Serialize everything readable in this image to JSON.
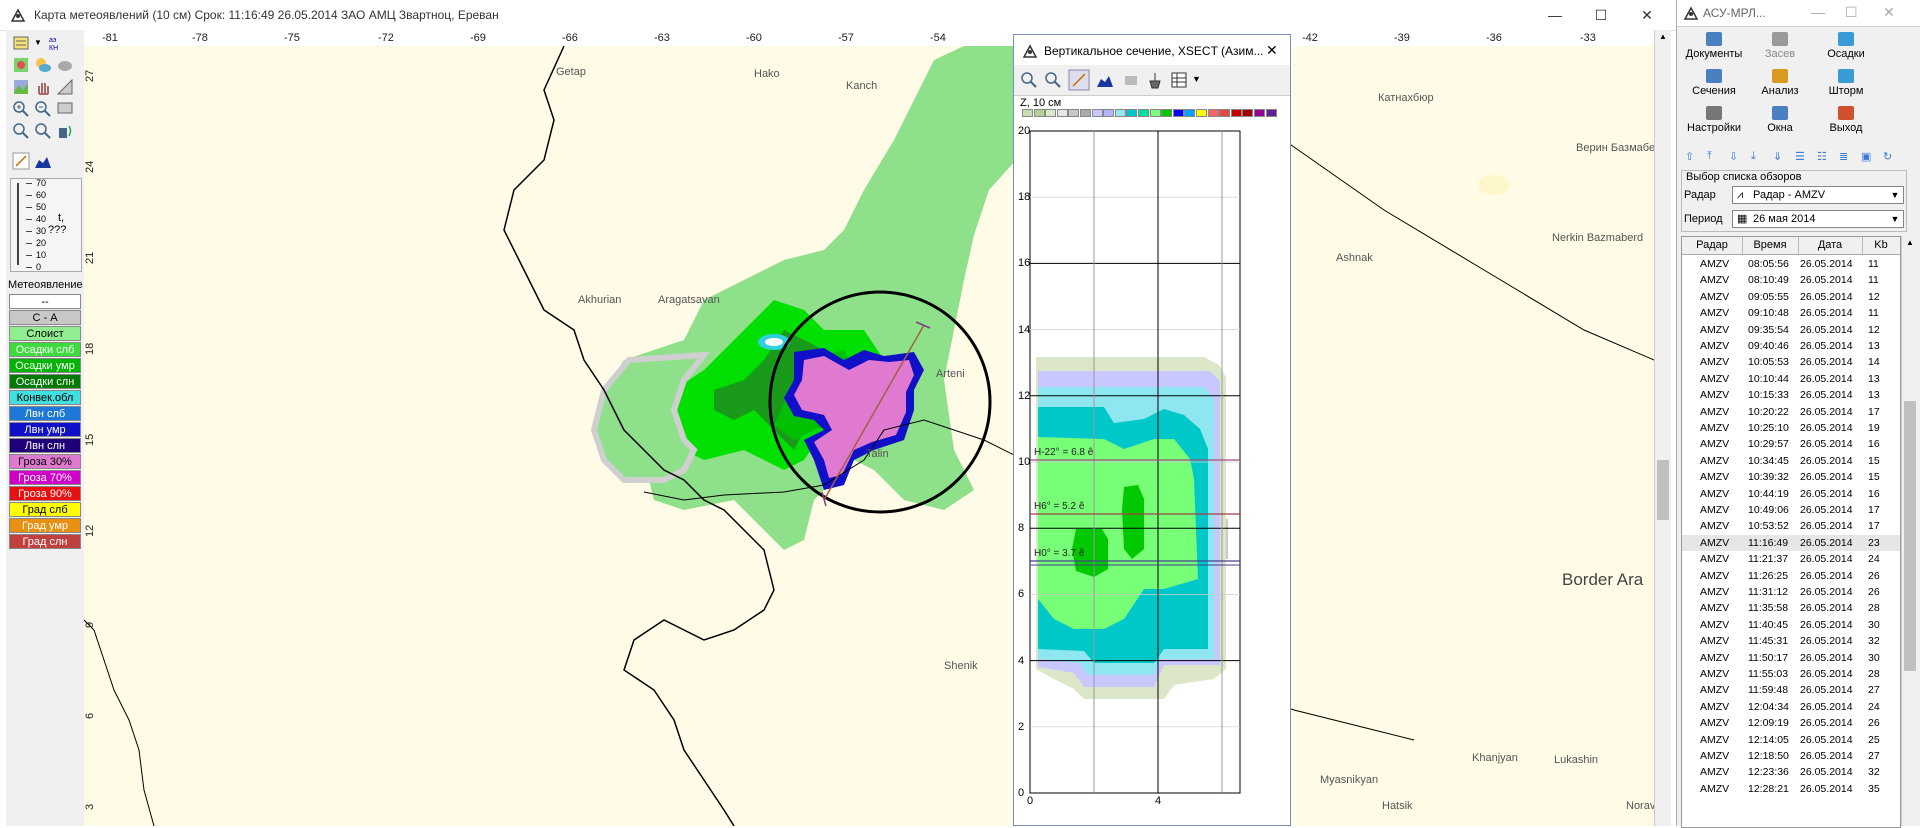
{
  "main_window": {
    "title": "Карта метеоявлений (10 см)   Срок: 11:16:49 26.05.2014   ЗАО АМЦ Звартноц, Ереван",
    "minimize": "—",
    "maximize": "☐",
    "close": "✕"
  },
  "toolbar": {
    "scale_values": [
      "70",
      "60",
      "50",
      "40",
      "30",
      "20",
      "10",
      "0"
    ],
    "scale_letter": "t,",
    "scale_unknown": "???",
    "legend_title": "Метеоявление",
    "legend_items": [
      {
        "label": "--",
        "bg": "#ffffff",
        "fg": "#000000"
      },
      {
        "label": "С - А",
        "bg": "#c8c8c8",
        "fg": "#000000"
      },
      {
        "label": "Слоист",
        "bg": "#90ee90",
        "fg": "#000000"
      },
      {
        "label": "Осадки слб",
        "bg": "#3cdc3c",
        "fg": "#ffffff"
      },
      {
        "label": "Осадки умр",
        "bg": "#00b400",
        "fg": "#ffffff"
      },
      {
        "label": "Осадки слн",
        "bg": "#007a00",
        "fg": "#ffffff"
      },
      {
        "label": "Конвек.обл",
        "bg": "#40e0e0",
        "fg": "#000000"
      },
      {
        "label": "Лвн слб",
        "bg": "#1e78d8",
        "fg": "#ffffff"
      },
      {
        "label": "Лвн умр",
        "bg": "#1010c8",
        "fg": "#ffffff"
      },
      {
        "label": "Лвн слн",
        "bg": "#200078",
        "fg": "#ffffff"
      },
      {
        "label": "Гроза 30%",
        "bg": "#e07ad0",
        "fg": "#000000"
      },
      {
        "label": "Гроза 70%",
        "bg": "#d000c8",
        "fg": "#ffffff"
      },
      {
        "label": "Гроза 90%",
        "bg": "#e81010",
        "fg": "#ffffff"
      },
      {
        "label": "Град слб",
        "bg": "#ffff00",
        "fg": "#000000"
      },
      {
        "label": "Град умр",
        "bg": "#e89010",
        "fg": "#ffffff"
      },
      {
        "label": "Град слн",
        "bg": "#c04040",
        "fg": "#ffffff"
      }
    ]
  },
  "map": {
    "x_ticks": [
      "-81",
      "-78",
      "-75",
      "-72",
      "-69",
      "-66",
      "-63",
      "-60",
      "-57",
      "-54",
      "-42",
      "-39",
      "-36",
      "-33"
    ],
    "y_ticks": [
      "27",
      "24",
      "21",
      "18",
      "15",
      "12",
      "9",
      "6",
      "3"
    ],
    "places": [
      "Getap",
      "Hako",
      "Kanch",
      "Akhurian",
      "Aragatsavan",
      "Arteni",
      "Talin",
      "Shenik",
      "Катнахбюр",
      "Верин Базмабе",
      "Nerkin Bazmaberd",
      "Ashnak",
      "Border Ara",
      "Khanjyan",
      "Lukashin",
      "Myasnikyan",
      "Hatsik",
      "Norav"
    ]
  },
  "vsec": {
    "title": "Вертикальное сечение, XSECT (Азим...",
    "close": "✕",
    "z_label": "Z, 10 см",
    "y_ticks": [
      "20",
      "18",
      "16",
      "14",
      "12",
      "10",
      "8",
      "6",
      "4",
      "2",
      "0"
    ],
    "x_ticks": [
      "0",
      "4"
    ],
    "h_labels": [
      "H-22° = 6.8 ê",
      "H6° = 5.2 ê",
      "H0° = 3.7 ê"
    ],
    "palette": [
      "#c8dcb4",
      "#b4d296",
      "#dce6c8",
      "#e6e6e6",
      "#c8c8c8",
      "#aaaaaa",
      "#c8c8ff",
      "#b4b4ff",
      "#96e6f0",
      "#00c8c8",
      "#00e0a0",
      "#78ff78",
      "#00c800",
      "#0000ff",
      "#00a0ff",
      "#ffff00",
      "#ff6464",
      "#e64646",
      "#c80000",
      "#a00000",
      "#960096",
      "#641e96"
    ]
  },
  "right_panel": {
    "title": "АСУ-МРЛ...",
    "big_buttons": [
      {
        "label": "Документы",
        "disabled": false
      },
      {
        "label": "Засев",
        "disabled": true
      },
      {
        "label": "Осадки",
        "disabled": false
      },
      {
        "label": "Сечения",
        "disabled": false
      },
      {
        "label": "Анализ",
        "disabled": false
      },
      {
        "label": "Шторм",
        "disabled": false
      },
      {
        "label": "Настройки",
        "disabled": false
      },
      {
        "label": "Окна",
        "disabled": false
      },
      {
        "label": "Выход",
        "disabled": false
      }
    ],
    "group_title": "Выбор списка обзоров",
    "radar_label": "Радар",
    "radar_value": "Радар - AMZV",
    "period_label": "Период",
    "period_value": "26 мая 2014",
    "columns": [
      "Радар",
      "Время",
      "Дата",
      "Kb"
    ],
    "rows": [
      [
        "AMZV",
        "08:05:56",
        "26.05.2014",
        "11"
      ],
      [
        "AMZV",
        "08:10:49",
        "26.05.2014",
        "11"
      ],
      [
        "AMZV",
        "09:05:55",
        "26.05.2014",
        "12"
      ],
      [
        "AMZV",
        "09:10:48",
        "26.05.2014",
        "11"
      ],
      [
        "AMZV",
        "09:35:54",
        "26.05.2014",
        "12"
      ],
      [
        "AMZV",
        "09:40:46",
        "26.05.2014",
        "13"
      ],
      [
        "AMZV",
        "10:05:53",
        "26.05.2014",
        "14"
      ],
      [
        "AMZV",
        "10:10:44",
        "26.05.2014",
        "13"
      ],
      [
        "AMZV",
        "10:15:33",
        "26.05.2014",
        "13"
      ],
      [
        "AMZV",
        "10:20:22",
        "26.05.2014",
        "17"
      ],
      [
        "AMZV",
        "10:25:10",
        "26.05.2014",
        "19"
      ],
      [
        "AMZV",
        "10:29:57",
        "26.05.2014",
        "16"
      ],
      [
        "AMZV",
        "10:34:45",
        "26.05.2014",
        "15"
      ],
      [
        "AMZV",
        "10:39:32",
        "26.05.2014",
        "15"
      ],
      [
        "AMZV",
        "10:44:19",
        "26.05.2014",
        "16"
      ],
      [
        "AMZV",
        "10:49:06",
        "26.05.2014",
        "17"
      ],
      [
        "AMZV",
        "10:53:52",
        "26.05.2014",
        "17"
      ],
      [
        "AMZV",
        "11:16:49",
        "26.05.2014",
        "23"
      ],
      [
        "AMZV",
        "11:21:37",
        "26.05.2014",
        "24"
      ],
      [
        "AMZV",
        "11:26:25",
        "26.05.2014",
        "26"
      ],
      [
        "AMZV",
        "11:31:12",
        "26.05.2014",
        "26"
      ],
      [
        "AMZV",
        "11:35:58",
        "26.05.2014",
        "28"
      ],
      [
        "AMZV",
        "11:40:45",
        "26.05.2014",
        "30"
      ],
      [
        "AMZV",
        "11:45:31",
        "26.05.2014",
        "32"
      ],
      [
        "AMZV",
        "11:50:17",
        "26.05.2014",
        "30"
      ],
      [
        "AMZV",
        "11:55:03",
        "26.05.2014",
        "28"
      ],
      [
        "AMZV",
        "11:59:48",
        "26.05.2014",
        "27"
      ],
      [
        "AMZV",
        "12:04:34",
        "26.05.2014",
        "24"
      ],
      [
        "AMZV",
        "12:09:19",
        "26.05.2014",
        "26"
      ],
      [
        "AMZV",
        "12:14:05",
        "26.05.2014",
        "25"
      ],
      [
        "AMZV",
        "12:18:50",
        "26.05.2014",
        "27"
      ],
      [
        "AMZV",
        "12:23:36",
        "26.05.2014",
        "32"
      ],
      [
        "AMZV",
        "12:28:21",
        "26.05.2014",
        "35"
      ]
    ],
    "selected_time": "11:16:49"
  }
}
